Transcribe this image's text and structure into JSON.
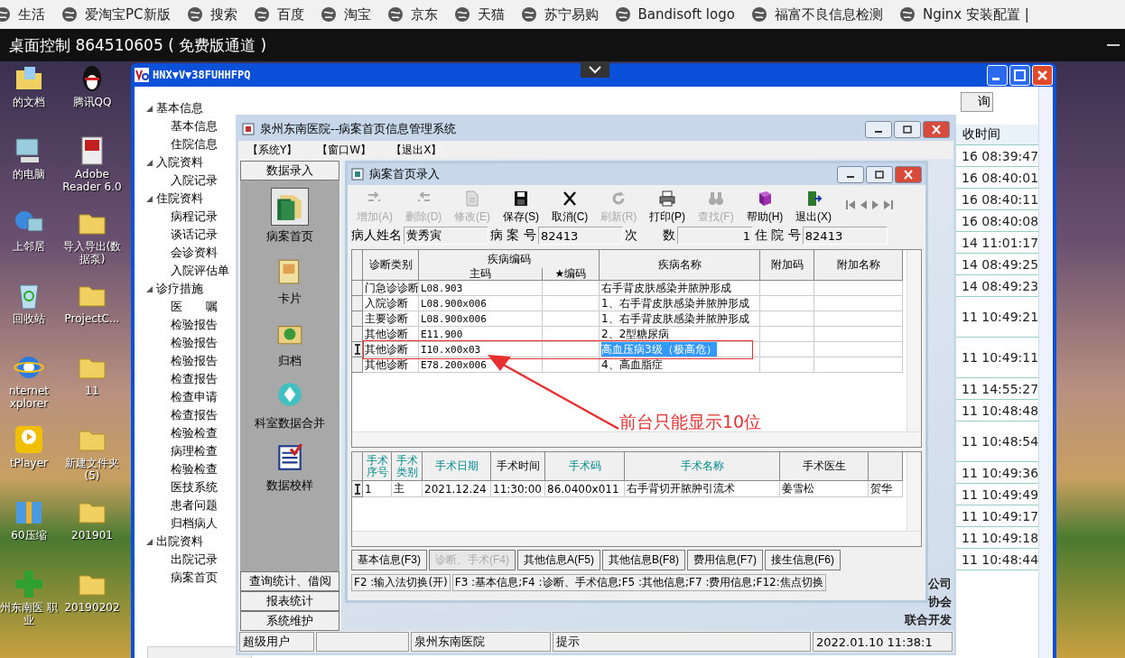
{
  "browser_bookmarks": [
    {
      "label": "生活"
    },
    {
      "label": "爱淘宝PC新版"
    },
    {
      "label": "搜索"
    },
    {
      "label": "百度"
    },
    {
      "label": "淘宝"
    },
    {
      "label": "京东"
    },
    {
      "label": "天猫"
    },
    {
      "label": "苏宁易购"
    },
    {
      "label": "Bandisoft logo"
    },
    {
      "label": "福富不良信息检测"
    },
    {
      "label": "Nginx 安装配置 |"
    }
  ],
  "remote_bar": {
    "title": "桌面控制 864510605 ( 免费版通道 )"
  },
  "desktop_icons": [
    {
      "label": "的文档",
      "kind": "documents"
    },
    {
      "label": "腾讯QQ",
      "kind": "qq"
    },
    {
      "label": "的电脑",
      "kind": "computer"
    },
    {
      "label": "Adobe Reader 6.0",
      "kind": "pdf"
    },
    {
      "label": "上邻居",
      "kind": "network"
    },
    {
      "label": "导入导出(数据泵)",
      "kind": "folder"
    },
    {
      "label": "回收站",
      "kind": "recycle"
    },
    {
      "label": "ProjectC...",
      "kind": "folder"
    },
    {
      "label": "nternet xplorer",
      "kind": "browser"
    },
    {
      "label": "11",
      "kind": "folder"
    },
    {
      "label": "tPlayer",
      "kind": "player"
    },
    {
      "label": "新建文件夹 (5)",
      "kind": "folder"
    },
    {
      "label": "60压缩",
      "kind": "archive"
    },
    {
      "label": "201901",
      "kind": "folder"
    },
    {
      "label": "州东南医 职业",
      "kind": "shortcut"
    },
    {
      "label": "20190202",
      "kind": "folder"
    }
  ],
  "outer_window": {
    "title": "HNX▼V▼38FUHHFPQ",
    "tree": [
      {
        "label": "基本信息",
        "expanded": true,
        "children": [
          {
            "label": "基本信息"
          },
          {
            "label": "住院信息"
          }
        ]
      },
      {
        "label": "入院资料",
        "expanded": true,
        "children": [
          {
            "label": "入院记录"
          }
        ]
      },
      {
        "label": "住院资料",
        "expanded": true,
        "children": [
          {
            "label": "病程记录"
          },
          {
            "label": "谈话记录"
          },
          {
            "label": "会诊资料"
          },
          {
            "label": "入院评估单"
          }
        ]
      },
      {
        "label": "诊疗措施",
        "expanded": true,
        "children": [
          {
            "label": "医　　嘱"
          },
          {
            "label": "检验报告"
          },
          {
            "label": "检验报告"
          },
          {
            "label": "检验报告"
          },
          {
            "label": "检查报告"
          },
          {
            "label": "检查申请"
          },
          {
            "label": "检查报告"
          },
          {
            "label": "检验检查"
          },
          {
            "label": "病理检查"
          },
          {
            "label": "检验检查"
          },
          {
            "label": "医技系统"
          },
          {
            "label": "患者问题"
          },
          {
            "label": "归档病人"
          }
        ]
      },
      {
        "label": "出院资料",
        "expanded": true,
        "children": [
          {
            "label": "出院记录"
          },
          {
            "label": "病案首页"
          }
        ]
      }
    ],
    "search_button": "询",
    "list_header": "收时间",
    "times": [
      {
        "text": "16 08:39:47",
        "tall": false
      },
      {
        "text": "16 08:40:01",
        "tall": false
      },
      {
        "text": "16 08:40:11",
        "tall": false
      },
      {
        "text": "16 08:40:08",
        "tall": false
      },
      {
        "text": "14 11:01:17",
        "tall": false
      },
      {
        "text": "14 08:49:25",
        "tall": false
      },
      {
        "text": "14 08:49:23",
        "tall": false
      },
      {
        "text": "11 10:49:21",
        "tall": true
      },
      {
        "text": "11 10:49:11",
        "tall": true
      },
      {
        "text": "11 14:55:27",
        "tall": false
      },
      {
        "text": "11 10:48:48",
        "tall": false
      },
      {
        "text": "11 10:48:54",
        "tall": true
      },
      {
        "text": "11 10:49:36",
        "tall": false
      },
      {
        "text": "11 10:49:49",
        "tall": false
      },
      {
        "text": "11 10:49:17",
        "tall": false
      },
      {
        "text": "11 10:49:18",
        "tall": false
      },
      {
        "text": "11 10:48:44",
        "tall": false
      }
    ]
  },
  "main_window": {
    "title": "泉州东南医院--病案首页信息管理系统",
    "menu": [
      "【系统Y】",
      "【窗口W】",
      "【退出X】"
    ],
    "sidebar": {
      "header": "数据录入",
      "items": [
        {
          "label": "病案首页",
          "selected": true
        },
        {
          "label": "卡片",
          "selected": false
        },
        {
          "label": "归档",
          "selected": false
        },
        {
          "label": "科室数据合并",
          "selected": false
        },
        {
          "label": "数据校样",
          "selected": false
        }
      ],
      "buttons": [
        "查询统计、借阅",
        "报表统计",
        "系统维护"
      ]
    },
    "background_texts": [
      "公司",
      "协会",
      "联合开发"
    ],
    "status_bar": {
      "user": "超级用户",
      "hospital": "泉州东南医院",
      "hint": "提示",
      "datetime": "2022.01.10 11:38:1"
    }
  },
  "record_window": {
    "title": "病案首页录入",
    "toolbar": [
      {
        "label": "增加(A)",
        "disabled": true
      },
      {
        "label": "删除(D)",
        "disabled": true
      },
      {
        "label": "修改(E)",
        "disabled": true
      },
      {
        "label": "保存(S)",
        "disabled": false
      },
      {
        "label": "取消(C)",
        "disabled": false
      },
      {
        "label": "刷新(R)",
        "disabled": true
      },
      {
        "label": "打印(P)",
        "disabled": false
      },
      {
        "label": "查找(F)",
        "disabled": true
      },
      {
        "label": "帮助(H)",
        "disabled": false
      },
      {
        "label": "退出(X)",
        "disabled": false
      }
    ],
    "fields": [
      {
        "label": "病人姓名",
        "value": "黄秀寅"
      },
      {
        "label": "病 案 号",
        "value": "82413"
      },
      {
        "label": "次　　数",
        "value": "1"
      },
      {
        "label": "住 院 号",
        "value": "82413"
      }
    ],
    "diagnosis_table": {
      "columns": {
        "category": "诊断类别",
        "code_group": "疾病编码",
        "main_code": "主码",
        "star_code": "★编码",
        "name": "疾病名称",
        "extra_code": "附加码",
        "extra_name": "附加名称"
      },
      "rows": [
        {
          "category": "门急诊诊断",
          "main_code": "L08.903",
          "name": "右手背皮肤感染并脓肿形成",
          "selected": false
        },
        {
          "category": "入院诊断",
          "main_code": "L08.900x006",
          "name": "1、右手背皮肤感染并脓肿形成",
          "selected": false
        },
        {
          "category": "主要诊断",
          "main_code": "L08.900x006",
          "name": "1、右手背皮肤感染并脓肿形成",
          "selected": false
        },
        {
          "category": "其他诊断",
          "main_code": "E11.900",
          "name": "2、2型糖尿病",
          "selected": false
        },
        {
          "category": "其他诊断",
          "main_code": "I10.x00x03",
          "name": "高血压病3级（极高危）",
          "selected": true
        },
        {
          "category": "其他诊断",
          "main_code": "E78.200x006",
          "name": "4、高血脂症",
          "selected": false
        }
      ]
    },
    "annotation": "前台只能显示10位",
    "surgery_table": {
      "columns": [
        {
          "label": "手术序号",
          "emphasized": true
        },
        {
          "label": "手术类别",
          "emphasized": true
        },
        {
          "label": "手术日期",
          "emphasized": true
        },
        {
          "label": "手术时间",
          "emphasized": false
        },
        {
          "label": "手术码",
          "emphasized": true
        },
        {
          "label": "手术名称",
          "emphasized": true
        },
        {
          "label": "手术医生",
          "emphasized": false
        }
      ],
      "rows": [
        {
          "cells": [
            "1",
            "主",
            "2021.12.24",
            "11:30:00",
            "86.0400x011",
            "右手背切开脓肿引流术",
            "姜雪松",
            "贺华"
          ],
          "selected": true
        }
      ]
    },
    "tabs": [
      {
        "label": "基本信息(F3)",
        "selected": false
      },
      {
        "label": "诊断、手术(F4)",
        "selected": true
      },
      {
        "label": "其他信息A(F5)",
        "selected": false
      },
      {
        "label": "其他信息B(F8)",
        "selected": false
      },
      {
        "label": "费用信息(F7)",
        "selected": false
      },
      {
        "label": "接生信息(F6)",
        "selected": false
      }
    ],
    "hint_bar": [
      "F2 :输入法切换(开)",
      "F3 :基本信息;F4 :诊断、手术信息;F5 :其他信息;F7 :费用信息;F12:焦点切换"
    ]
  }
}
